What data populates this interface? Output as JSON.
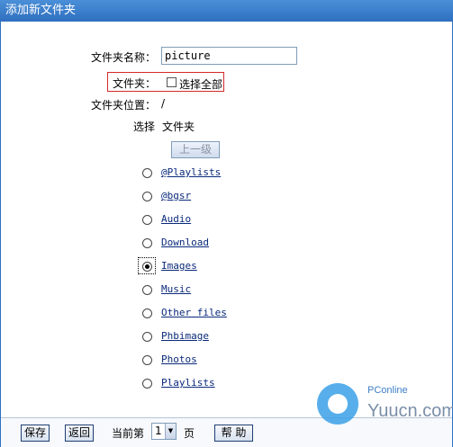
{
  "window": {
    "title": "添加新文件夹"
  },
  "form": {
    "name_label": "文件夹名称：",
    "name_value": "picture",
    "folder_label": "文件夹：",
    "select_all_label": "选择全部",
    "select_all_checked": false,
    "location_label": "文件夹位置：",
    "location_value": "/"
  },
  "list_header": {
    "select": "选择",
    "folder": "文件夹"
  },
  "up_button": "上一级",
  "folders": [
    {
      "name": "@Playlists",
      "selected": false
    },
    {
      "name": "@bgsr",
      "selected": false
    },
    {
      "name": "Audio",
      "selected": false
    },
    {
      "name": "Download",
      "selected": false
    },
    {
      "name": "Images",
      "selected": true
    },
    {
      "name": "Music",
      "selected": false
    },
    {
      "name": "Other files",
      "selected": false
    },
    {
      "name": "Phbimage",
      "selected": false
    },
    {
      "name": "Photos",
      "selected": false
    },
    {
      "name": "Playlists",
      "selected": false
    }
  ],
  "bottom": {
    "save": "保存",
    "back": "返回",
    "current_page_prefix": "当前第",
    "page_value": "1",
    "page_suffix": "页",
    "help": "帮 助"
  },
  "watermark": {
    "brand": "PConline",
    "site": "Yuucn.com"
  }
}
